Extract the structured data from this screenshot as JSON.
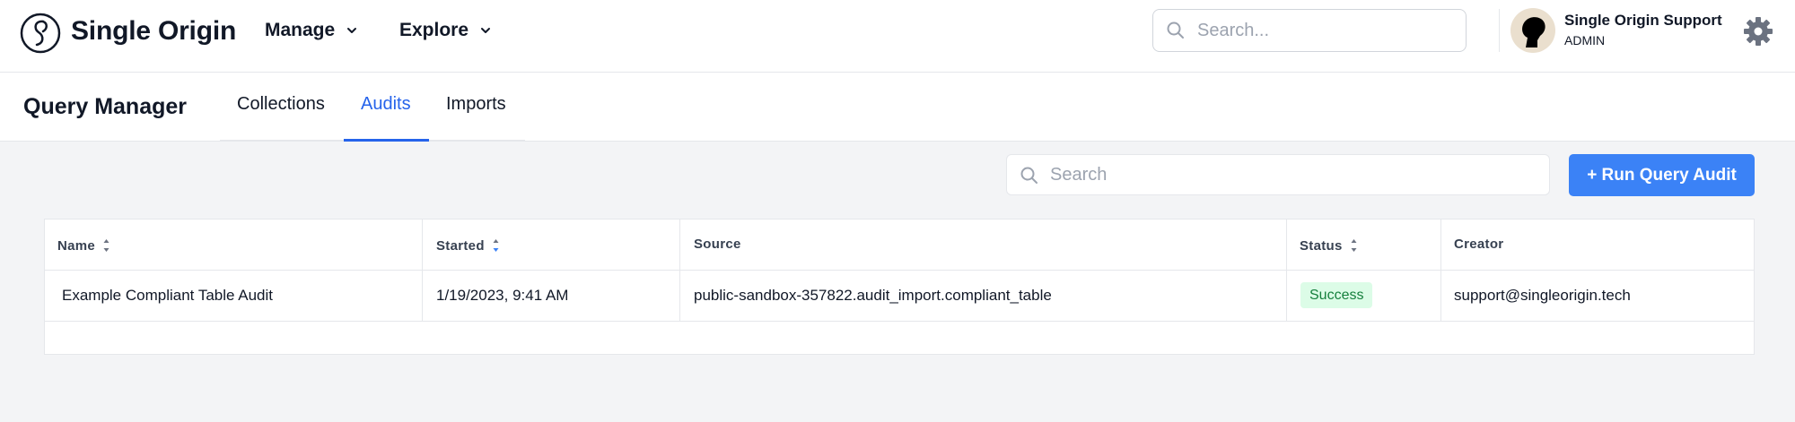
{
  "nav": {
    "brand": "Single Origin",
    "menus": [
      {
        "label": "Manage"
      },
      {
        "label": "Explore"
      }
    ],
    "search_placeholder": "Search...",
    "user": {
      "name": "Single Origin Support",
      "role": "ADMIN"
    }
  },
  "subheader": {
    "title": "Query Manager",
    "tabs": [
      {
        "label": "Collections"
      },
      {
        "label": "Audits",
        "active": true
      },
      {
        "label": "Imports"
      }
    ]
  },
  "toolbar": {
    "search_placeholder": "Search",
    "run_label": "+ Run Query Audit"
  },
  "table": {
    "columns": [
      "Name",
      "Started",
      "Source",
      "Status",
      "Creator"
    ],
    "rows": [
      {
        "name": "Example Compliant Table Audit",
        "started": "1/19/2023, 9:41 AM",
        "source": "public-sandbox-357822.audit_import.compliant_table",
        "status": "Success",
        "creator": "support@singleorigin.tech"
      }
    ]
  },
  "colors": {
    "accent": "#3b82f6",
    "active_tab": "#2563eb",
    "success_bg": "#dcfce7",
    "success_text": "#15803d",
    "page_bg": "#f3f4f6"
  },
  "icons": [
    "single-origin-logo-icon",
    "chevron-down-icon",
    "search-icon",
    "avatar",
    "gear-icon",
    "sort-icon"
  ]
}
